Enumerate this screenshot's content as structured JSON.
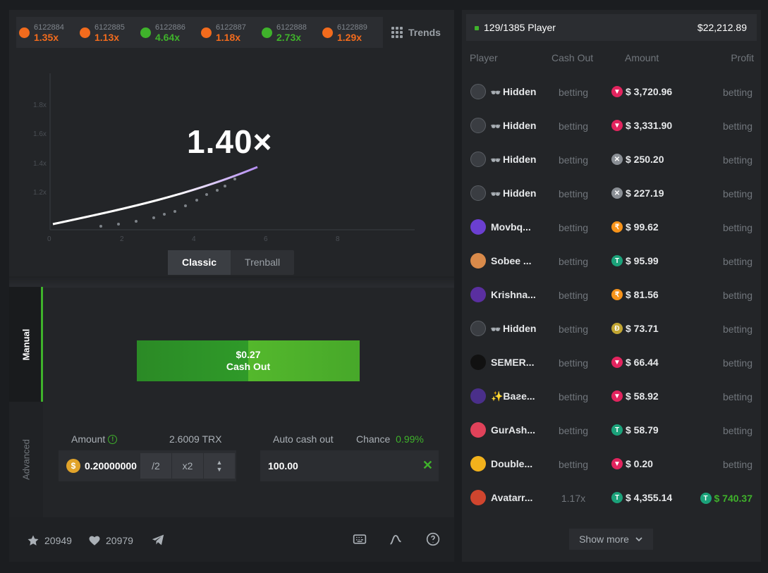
{
  "history": [
    {
      "id": "6122884",
      "mult": "1.35x",
      "color": "#f26b1d"
    },
    {
      "id": "6122885",
      "mult": "1.13x",
      "color": "#f26b1d"
    },
    {
      "id": "6122886",
      "mult": "4.64x",
      "color": "#3fb22b"
    },
    {
      "id": "6122887",
      "mult": "1.18x",
      "color": "#f26b1d"
    },
    {
      "id": "6122888",
      "mult": "2.73x",
      "color": "#3fb22b"
    },
    {
      "id": "6122889",
      "mult": "1.29x",
      "color": "#f26b1d"
    }
  ],
  "trends_label": "Trends",
  "multiplier": "1.40×",
  "chart": {
    "y_ticks": [
      "1.8x",
      "1.6x",
      "1.4x",
      "1.2x"
    ],
    "x_ticks": [
      "0",
      "2",
      "4",
      "6",
      "8"
    ],
    "curve_end": 1.4
  },
  "modes": [
    "Classic",
    "Trenball"
  ],
  "side_tabs": {
    "manual": "Manual",
    "advanced": "Advanced"
  },
  "cashout": {
    "amount": "$0.27",
    "label": "Cash Out"
  },
  "bet": {
    "amount_label": "Amount",
    "trx_value": "2.6009 TRX",
    "amount_value": "0.20000000",
    "half_label": "/2",
    "double_label": "x2",
    "coin_symbol": "$"
  },
  "auto": {
    "label": "Auto cash out",
    "chance_label": "Chance",
    "chance_value": "0.99%",
    "value": "100.00"
  },
  "footer": {
    "stars": "20949",
    "likes": "20979"
  },
  "players_panel": {
    "count": "129/1385 Player",
    "total": "$22,212.89",
    "columns": {
      "player": "Player",
      "cashout": "Cash Out",
      "amount": "Amount",
      "profit": "Profit"
    },
    "rows": [
      {
        "name": "Hidden",
        "hidden": true,
        "cashout": "betting",
        "amount": "$ 3,720.96",
        "token": "trx",
        "profit": "betting"
      },
      {
        "name": "Hidden",
        "hidden": true,
        "cashout": "betting",
        "amount": "$ 3,331.90",
        "token": "trx",
        "profit": "betting"
      },
      {
        "name": "Hidden",
        "hidden": true,
        "cashout": "betting",
        "amount": "$ 250.20",
        "token": "x",
        "profit": "betting"
      },
      {
        "name": "Hidden",
        "hidden": true,
        "cashout": "betting",
        "amount": "$ 227.19",
        "token": "x",
        "profit": "betting"
      },
      {
        "name": "Movbq...",
        "hidden": false,
        "cashout": "betting",
        "amount": "$ 99.62",
        "token": "btc",
        "profit": "betting"
      },
      {
        "name": "Sobee ...",
        "hidden": false,
        "cashout": "betting",
        "amount": "$ 95.99",
        "token": "usdt",
        "profit": "betting"
      },
      {
        "name": "Krishna...",
        "hidden": false,
        "cashout": "betting",
        "amount": "$ 81.56",
        "token": "btc",
        "profit": "betting"
      },
      {
        "name": "Hidden",
        "hidden": true,
        "cashout": "betting",
        "amount": "$ 73.71",
        "token": "doge",
        "profit": "betting"
      },
      {
        "name": "SEMER...",
        "hidden": false,
        "cashout": "betting",
        "amount": "$ 66.44",
        "token": "trx",
        "profit": "betting"
      },
      {
        "name": "✨Baƨe...",
        "hidden": false,
        "cashout": "betting",
        "amount": "$ 58.92",
        "token": "trx",
        "profit": "betting"
      },
      {
        "name": "GurAsh...",
        "hidden": false,
        "cashout": "betting",
        "amount": "$ 58.79",
        "token": "usdt",
        "profit": "betting"
      },
      {
        "name": "Double...",
        "hidden": false,
        "cashout": "betting",
        "amount": "$ 0.20",
        "token": "trx",
        "profit": "betting"
      },
      {
        "name": "Avatarr...",
        "hidden": false,
        "cashout": "1.17x",
        "amount": "$ 4,355.14",
        "token": "usdt",
        "profit": "$ 740.37",
        "win": true
      }
    ],
    "show_more": "Show more"
  },
  "colors": {
    "accent_green": "#3fb22b",
    "loss_orange": "#f26b1d",
    "trx_red": "#e2245e",
    "usdt_green": "#1ba27a",
    "btc_orange": "#f7931a",
    "doge_yellow": "#c2a633",
    "x_gray": "#8a8f95"
  }
}
